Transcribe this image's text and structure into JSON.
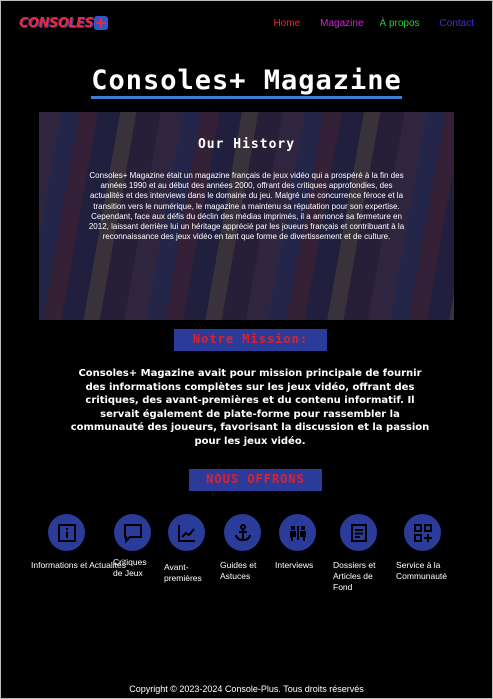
{
  "header": {
    "logo_text": "CONSOLES",
    "nav": [
      {
        "label": "Home",
        "color": "#ff2020"
      },
      {
        "label": "Magazine",
        "color": "#d920d9"
      },
      {
        "label": "À propos",
        "color": "#22d322"
      },
      {
        "label": "Contact",
        "color": "#3c2fe8"
      }
    ]
  },
  "main": {
    "title": "Consoles+ Magazine"
  },
  "history": {
    "title": "Our History",
    "text": "Consoles+ Magazine était un magazine français de jeux vidéo qui a prospéré à la fin des années 1990 et au début des années 2000, offrant des critiques approfondies, des actualités et des interviews dans le domaine du jeu. Malgré une concurrence féroce et la transition vers le numérique, le magazine a maintenu sa réputation pour son expertise. Cependant, face aux défis du déclin des médias imprimés, il a annoncé sa fermeture en 2012, laissant derrière lui un héritage apprécié par les joueurs français et contribuant à la reconnaissance des jeux vidéo en tant que forme de divertissement et de culture."
  },
  "mission": {
    "title": "Notre Mission:",
    "text": "Consoles+ Magazine avait pour mission principale de fournir des informations complètes sur les jeux vidéo, offrant des critiques, des avant-premières et du contenu informatif. Il servait également de plate-forme pour rassembler la communauté des joueurs, favorisant la discussion et la passion pour les jeux vidéo."
  },
  "offers": {
    "title": "NOUS OFFRONS",
    "items": [
      {
        "label": "Informations et Actualités",
        "icon": "info-icon"
      },
      {
        "label": "Critiques de Jeux",
        "icon": "chat-icon"
      },
      {
        "label": "Avant-premières",
        "icon": "chart-icon"
      },
      {
        "label": "Guides et Astuces",
        "icon": "anchor-icon"
      },
      {
        "label": "Interviews",
        "icon": "people-icon"
      },
      {
        "label": "Dossiers et Articles de Fond",
        "icon": "document-icon"
      },
      {
        "label": "Service à la Communauté",
        "icon": "grid-plus-icon"
      }
    ]
  },
  "footer": {
    "text": "Copyright © 2023-2024 Console-Plus. Tous droits réservés"
  },
  "colors": {
    "accent_blue": "#2b3b9a",
    "accent_red": "#e0202a",
    "title_underline": "#3e7fd6"
  }
}
